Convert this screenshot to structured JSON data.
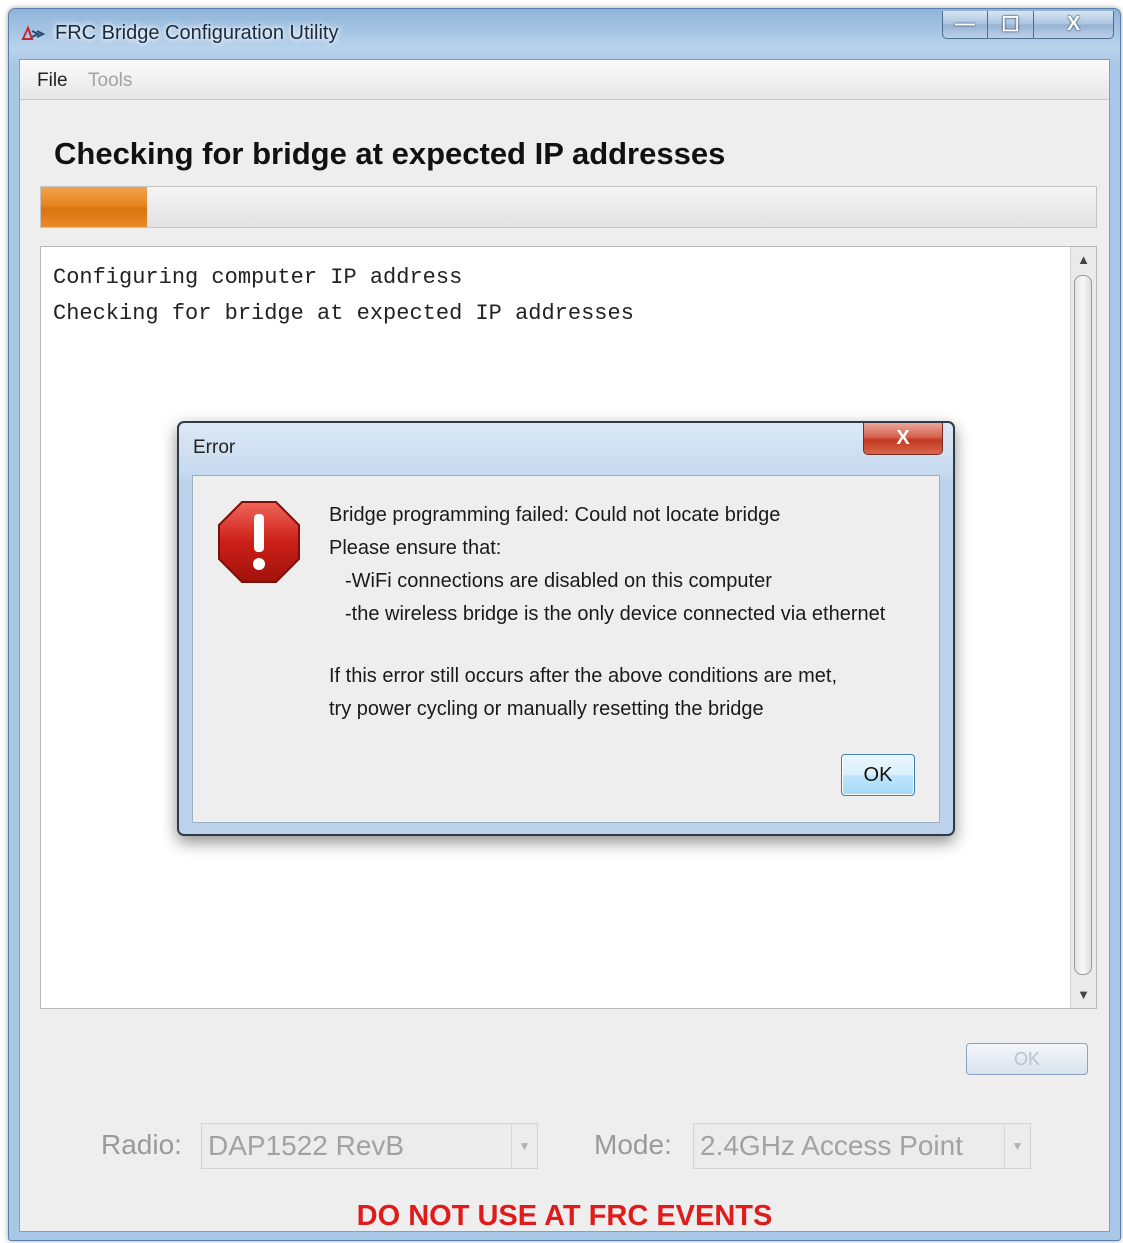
{
  "window": {
    "title": "FRC Bridge Configuration Utility",
    "controls": {
      "minimize": "—",
      "maximize": "☐",
      "close": "X"
    }
  },
  "menu": {
    "file": "File",
    "tools": "Tools"
  },
  "heading": "Checking for bridge at expected IP addresses",
  "progress": {
    "fraction": 0.1
  },
  "log": {
    "lines": [
      "Configuring computer IP address",
      "Checking for bridge at expected IP addresses"
    ],
    "scroll_up": "▲",
    "scroll_down": "▼"
  },
  "dialog": {
    "title": "Error",
    "close": "X",
    "icon": "error-stop-icon",
    "message": {
      "line1": "Bridge programming failed: Could not locate bridge",
      "line2": "Please ensure that:",
      "line3": "-WiFi connections are disabled on this computer",
      "line4": "-the wireless bridge is the only device connected via ethernet",
      "line5": "If this error still occurs after the above conditions are met,",
      "line6": "try power cycling or manually resetting the bridge"
    },
    "ok": "OK"
  },
  "footer": {
    "ok": "OK",
    "radio_label": "Radio:",
    "radio_value": "DAP1522 RevB",
    "mode_label": "Mode:",
    "mode_value": "2.4GHz Access Point",
    "dropdown_arrow": "▼",
    "warning": "DO NOT USE AT FRC EVENTS"
  },
  "colors": {
    "accent": "#e68420",
    "warning": "#e01b1b",
    "title_blue": "#a9c7e6"
  }
}
